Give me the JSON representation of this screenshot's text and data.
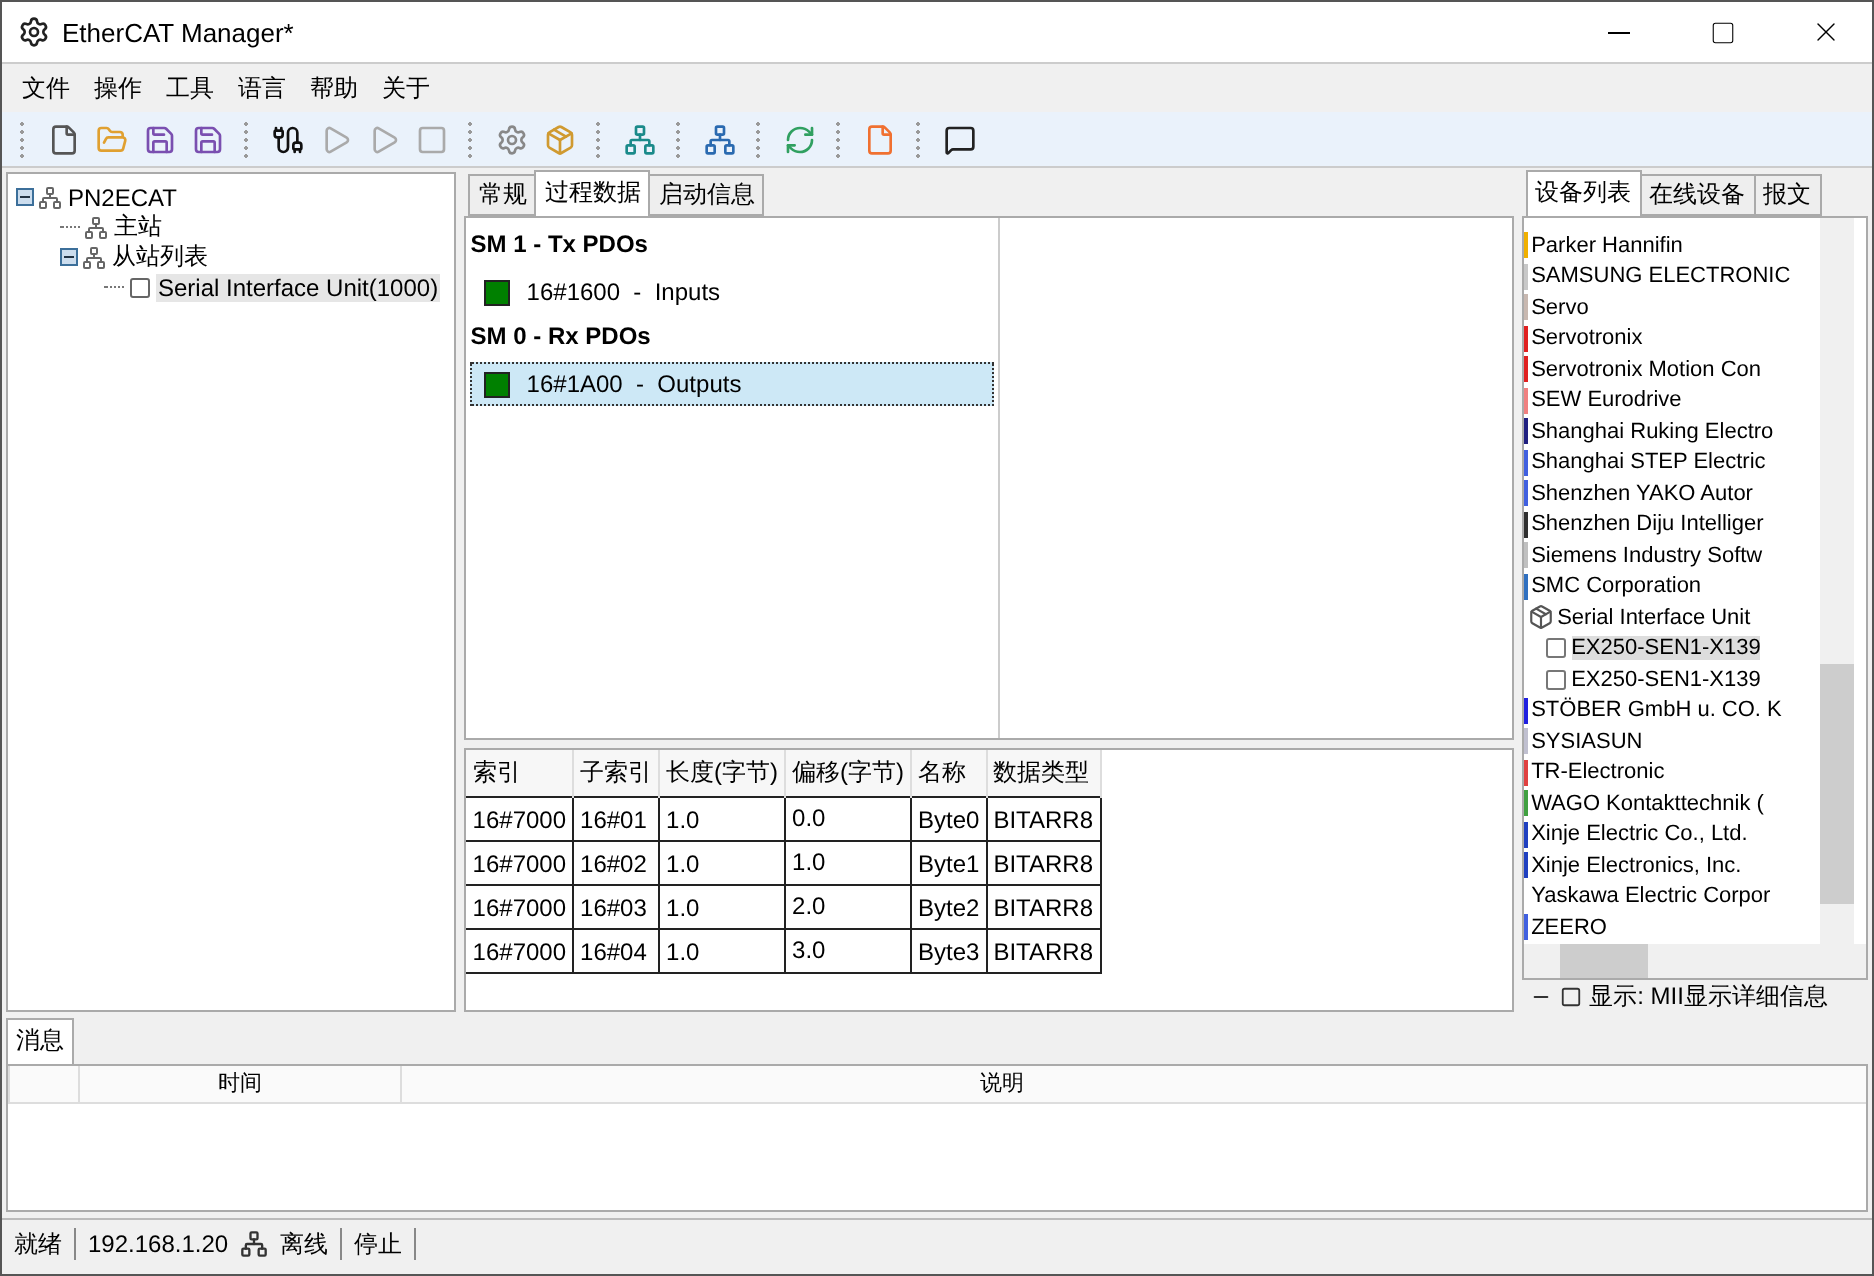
{
  "window": {
    "title": "EtherCAT Manager*"
  },
  "menu": [
    "文件",
    "操作",
    "工具",
    "语言",
    "帮助",
    "关于"
  ],
  "toolbar": [
    {
      "disabled": false
    },
    {
      "disabled": false
    },
    {
      "disabled": false
    },
    {
      "disabled": false
    },
    {
      "disabled": false
    },
    {
      "disabled": true
    },
    {
      "disabled": true
    },
    {
      "disabled": true
    },
    {
      "disabled": false
    },
    {
      "disabled": false
    },
    {
      "disabled": false
    },
    {
      "disabled": false
    },
    {
      "disabled": false
    },
    {
      "disabled": false
    },
    {
      "disabled": false
    }
  ],
  "tree": [
    {
      "label": "PN2ECAT",
      "expanded": true,
      "selected": false,
      "children": [
        {
          "label": "主站",
          "selected": false
        },
        {
          "label": "从站列表",
          "expanded": true,
          "selected": false,
          "children": [
            {
              "label": "Serial Interface Unit(1000)",
              "selected": true
            }
          ]
        }
      ]
    }
  ],
  "detail_tabs": [
    {
      "label": "常规",
      "selected": false
    },
    {
      "label": "过程数据",
      "selected": true
    },
    {
      "label": "启动信息",
      "selected": false
    }
  ],
  "pdo_groups": [
    {
      "heading": "SM 1 - Tx PDOs",
      "items": [
        {
          "label": "16#1600  -  Inputs",
          "color": "#008000",
          "selected": false
        }
      ]
    },
    {
      "heading": "SM 0 - Rx PDOs",
      "items": [
        {
          "label": "16#1A00  -  Outputs",
          "color": "#008000",
          "selected": true
        }
      ]
    }
  ],
  "entries_table": {
    "columns": [
      "索引",
      "子索引",
      "长度(字节)",
      "偏移(字节)",
      "名称",
      "数据类型"
    ],
    "rows": [
      [
        "16#7000",
        "16#01",
        "1.0",
        "0.0",
        "Byte0",
        "BITARR8"
      ],
      [
        "16#7000",
        "16#02",
        "1.0",
        "1.0",
        "Byte1",
        "BITARR8"
      ],
      [
        "16#7000",
        "16#03",
        "1.0",
        "2.0",
        "Byte2",
        "BITARR8"
      ],
      [
        "16#7000",
        "16#04",
        "1.0",
        "3.0",
        "Byte3",
        "BITARR8"
      ]
    ]
  },
  "side_tabs": [
    {
      "label": "设备列表",
      "selected": true
    },
    {
      "label": "在线设备",
      "selected": false
    },
    {
      "label": "报文",
      "selected": false
    }
  ],
  "device_list": [
    {
      "kind": "vendor",
      "label": "Parker Hannifin",
      "color": "#f0b000",
      "selected": false
    },
    {
      "kind": "vendor",
      "label": "SAMSUNG ELECTRONIC",
      "color": "#c8c8c8",
      "selected": false
    },
    {
      "kind": "vendor",
      "label": "Servo",
      "color": "#c8b8b0",
      "selected": false
    },
    {
      "kind": "vendor",
      "label": "Servotronix",
      "color": "#e02020",
      "selected": false
    },
    {
      "kind": "vendor",
      "label": "Servotronix Motion Con",
      "color": "#e02020",
      "selected": false
    },
    {
      "kind": "vendor",
      "label": "SEW Eurodrive",
      "color": "#f08080",
      "selected": false
    },
    {
      "kind": "vendor",
      "label": "Shanghai Ruking Electro",
      "color": "#202080",
      "selected": false
    },
    {
      "kind": "vendor",
      "label": "Shanghai STEP Electric",
      "color": "#4060e0",
      "selected": false
    },
    {
      "kind": "vendor",
      "label": "Shenzhen  YAKO  Autor",
      "color": "#4060e0",
      "selected": false
    },
    {
      "kind": "vendor",
      "label": "Shenzhen Diju Intelliger",
      "color": "#303030",
      "selected": false
    },
    {
      "kind": "vendor",
      "label": "Siemens Industry Softw",
      "color": "#c0c0c0",
      "selected": false
    },
    {
      "kind": "vendor",
      "label": "SMC Corporation",
      "color": "#3070c0",
      "selected": false
    },
    {
      "kind": "group",
      "label": "Serial Interface Unit",
      "selected": false
    },
    {
      "kind": "device",
      "label": "EX250-SEN1-X139",
      "selected": true
    },
    {
      "kind": "device",
      "label": "EX250-SEN1-X139",
      "selected": false
    },
    {
      "kind": "vendor",
      "label": "STÖBER GmbH u. CO. K",
      "color": "#2020e0",
      "selected": false
    },
    {
      "kind": "vendor",
      "label": "SYSIASUN",
      "color": "#c0c0d0",
      "selected": false
    },
    {
      "kind": "vendor",
      "label": "TR-Electronic",
      "color": "#e04040",
      "selected": false
    },
    {
      "kind": "vendor",
      "label": "WAGO Kontakttechnik (",
      "color": "#40a040",
      "selected": false
    },
    {
      "kind": "vendor",
      "label": "Xinje Electric Co., Ltd.",
      "color": "#2040c0",
      "selected": false
    },
    {
      "kind": "vendor",
      "label": "Xinje Electronics, Inc.",
      "color": "#2040c0",
      "selected": false
    },
    {
      "kind": "vendor",
      "label": "Yaskawa Electric Corpor",
      "selected": false
    },
    {
      "kind": "vendor",
      "label": "ZEERO",
      "color": "#4060e0",
      "selected": false
    }
  ],
  "side_footer": "显示: MII显示详细信息",
  "messages": {
    "tab": "消息",
    "columns": [
      "时间",
      "说明"
    ]
  },
  "status_bar": {
    "state": "就绪",
    "ip": "192.168.1.20",
    "connection": "离线",
    "run": "停止"
  }
}
